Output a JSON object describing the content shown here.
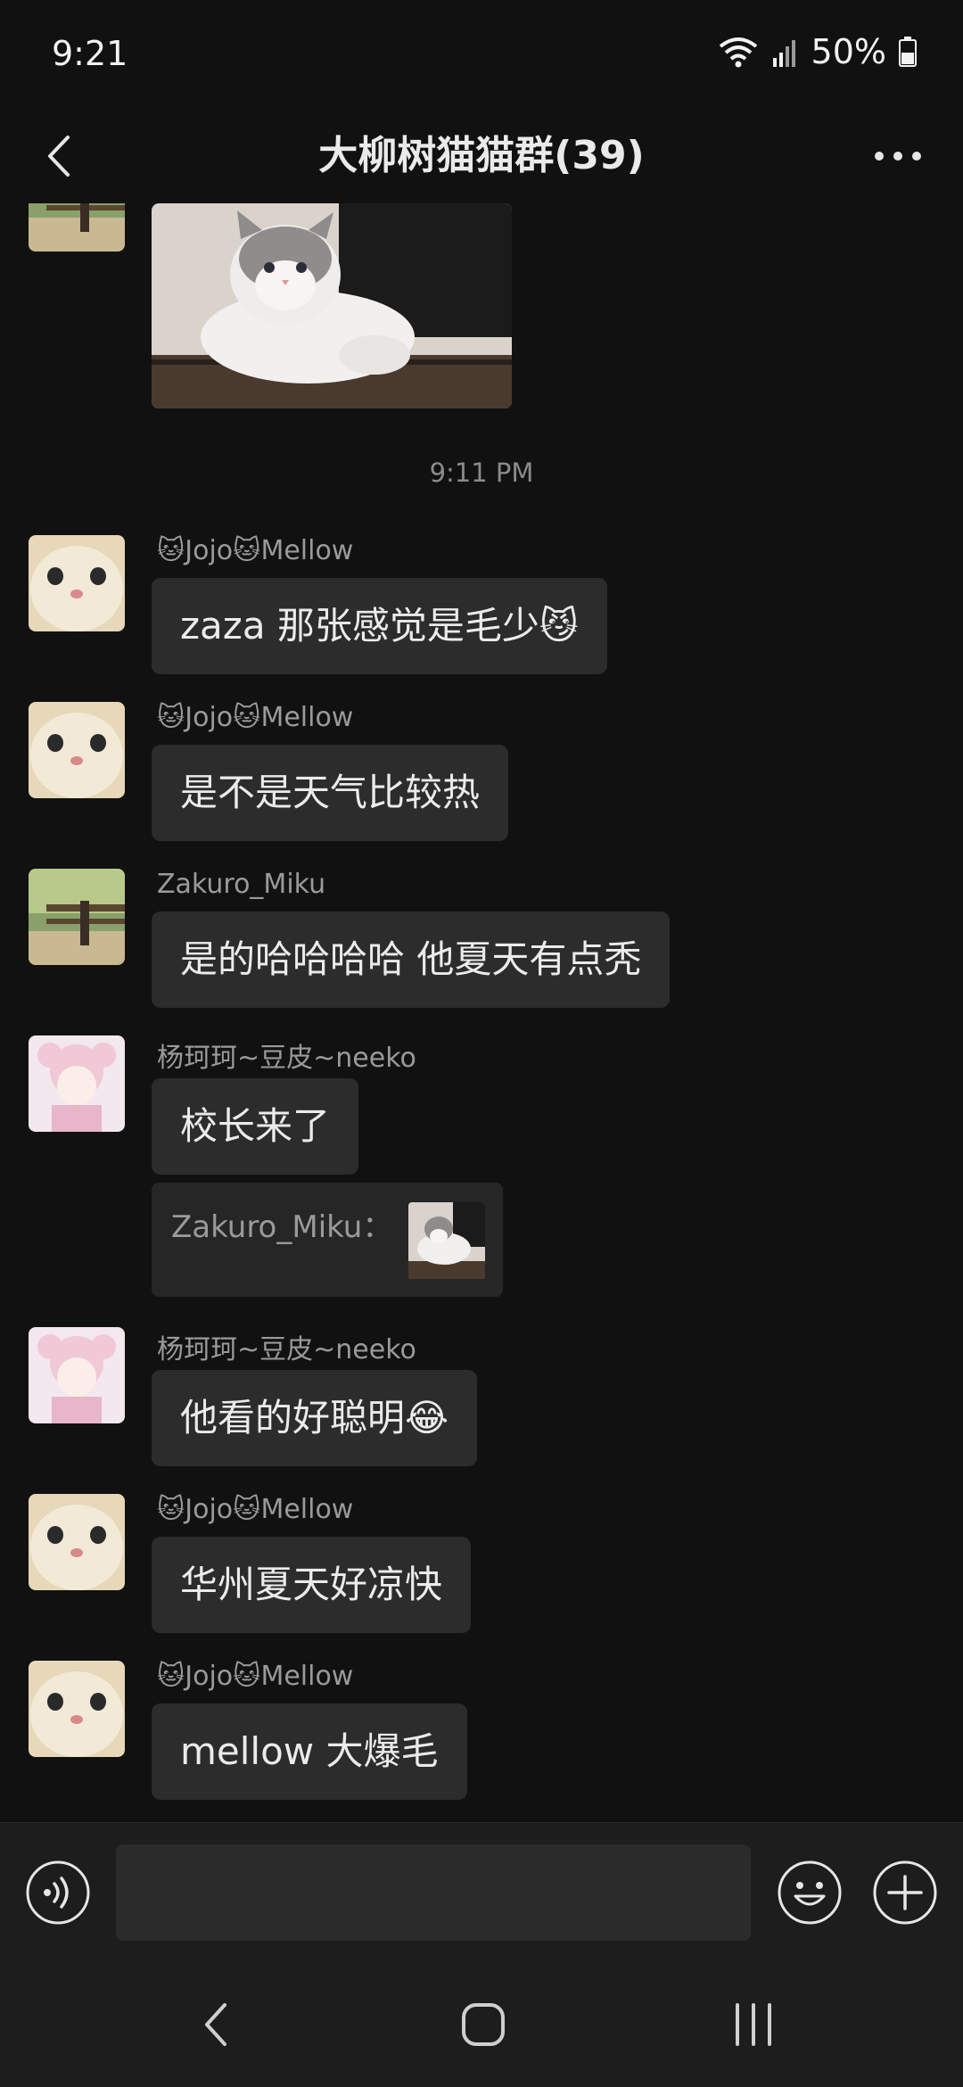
{
  "status_bar": {
    "time": "9:21",
    "battery_pct": "50%"
  },
  "header": {
    "title": "大柳树猫猫群(39)"
  },
  "timestamp": "9:11 PM",
  "messages": [
    {
      "sender": "🐱Jojo🐱Mellow",
      "text": "zaza 那张感觉是毛少😼"
    },
    {
      "sender": "🐱Jojo🐱Mellow",
      "text": "是不是天气比较热"
    },
    {
      "sender": "Zakuro_Miku",
      "text": "是的哈哈哈哈 他夏天有点秃"
    },
    {
      "sender": "杨珂珂~豆皮~neeko",
      "text": "校长来了",
      "quote": "Zakuro_Miku："
    },
    {
      "sender": "杨珂珂~豆皮~neeko",
      "text": "他看的好聪明😂"
    },
    {
      "sender": "🐱Jojo🐱Mellow",
      "text": "华州夏天好凉快"
    },
    {
      "sender": "🐱Jojo🐱Mellow",
      "text": "mellow 大爆毛"
    }
  ],
  "input": {
    "placeholder": ""
  },
  "icons": {
    "back": "chevron-left-icon",
    "more": "more-dots-icon",
    "voice": "voice-icon",
    "emoji": "emoji-icon",
    "add": "plus-circle-icon",
    "wifi": "wifi-icon",
    "signal": "signal-icon",
    "battery": "battery-icon"
  }
}
